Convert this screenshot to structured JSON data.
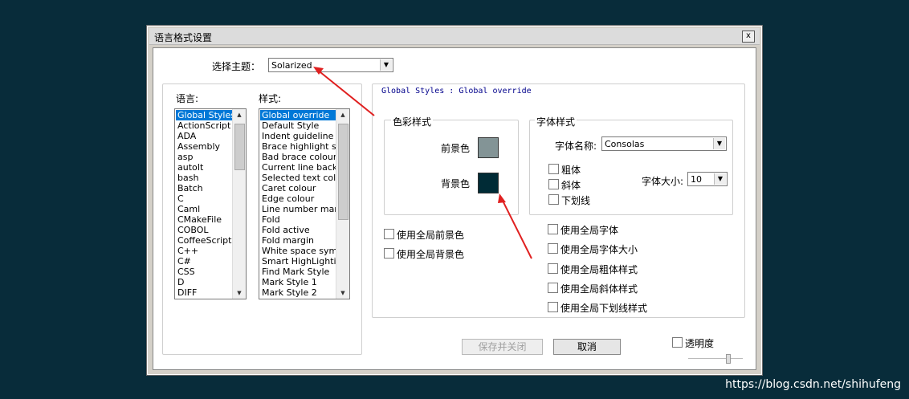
{
  "dialog": {
    "title": "语言格式设置",
    "close_glyph": "x",
    "theme_label": "选择主题：",
    "theme_value": "Solarized",
    "language_label": "语言:",
    "style_label": "样式:",
    "languages": [
      "Global Styles",
      "ActionScript",
      "ADA",
      "Assembly",
      "asp",
      "autoIt",
      "bash",
      "Batch",
      "C",
      "Caml",
      "CMakeFile",
      "COBOL",
      "CoffeeScript",
      "C++",
      "C#",
      "CSS",
      "D",
      "DIFF"
    ],
    "styles": [
      "Global override",
      "Default Style",
      "Indent guideline sty",
      "Brace highlight style",
      "Bad brace colour",
      "Current line backgr",
      "Selected text colou",
      "Caret colour",
      "Edge colour",
      "Line number margin",
      "Fold",
      "Fold active",
      "Fold margin",
      "White space symbo",
      "Smart HighLighting",
      "Find Mark Style",
      "Mark Style 1",
      "Mark Style 2"
    ],
    "style_header": "Global Styles : Global override",
    "color_group": {
      "title": "色彩样式",
      "fg_label": "前景色",
      "bg_label": "背景色",
      "fg_color": "#839496",
      "bg_color": "#002b36"
    },
    "font_group": {
      "title": "字体样式",
      "font_name_label": "字体名称:",
      "font_name_value": "Consolas",
      "bold": "粗体",
      "italic": "斜体",
      "underline": "下划线",
      "size_label": "字体大小:",
      "size_value": "10"
    },
    "global_fg": "使用全局前景色",
    "global_bg": "使用全局背景色",
    "global_font": "使用全局字体",
    "global_size": "使用全局字体大小",
    "global_bold": "使用全局粗体样式",
    "global_italic": "使用全局斜体样式",
    "global_underline": "使用全局下划线样式",
    "save_close": "保存并关闭",
    "cancel": "取消",
    "transparency": "透明度"
  },
  "watermark": "https://blog.csdn.net/shihufeng",
  "accent_arrow_color": "#e02020",
  "selection_color": "#0078d7"
}
